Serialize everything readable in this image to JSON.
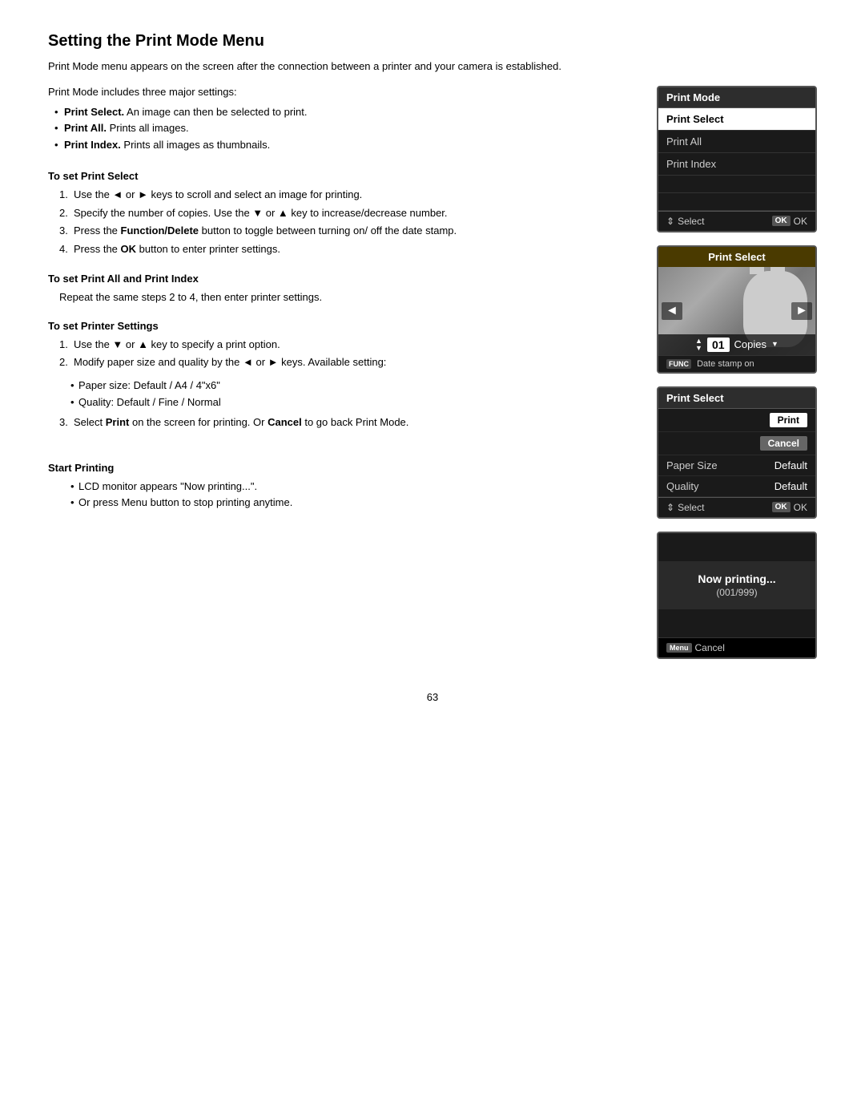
{
  "page": {
    "title": "Setting the Print Mode Menu",
    "intro": "Print Mode menu appears on the screen after the connection between a printer and your camera is established.",
    "includes_label": "Print Mode includes three major settings:",
    "bullets": [
      {
        "bold": "Print Select.",
        "text": " An image can then be selected to print."
      },
      {
        "bold": "Print All.",
        "text": " Prints all images."
      },
      {
        "bold": "Print Index.",
        "text": " Prints all images as thumbnails."
      }
    ],
    "sections": [
      {
        "id": "print-select",
        "title": "To set Print Select",
        "steps": [
          {
            "num": "1.",
            "text": "Use the ◄ or ► keys to scroll and select an image for printing."
          },
          {
            "num": "2.",
            "text": "Specify the number of copies. Use the ▼ or ▲ key to increase/decrease number."
          },
          {
            "num": "3.",
            "text": "Press the Function/Delete button to toggle between turning on/ off the date stamp."
          },
          {
            "num": "4.",
            "text": "Press the OK button to enter printer settings."
          }
        ]
      },
      {
        "id": "print-all",
        "title": "To set Print All and Print Index",
        "note": "Repeat the same steps 2 to 4, then enter printer settings."
      },
      {
        "id": "printer-settings",
        "title": "To set Printer Settings",
        "steps": [
          {
            "num": "1.",
            "text": "Use the ▼ or ▲ key to specify a print option."
          },
          {
            "num": "2.",
            "text": "Modify paper size and quality by the ◄ or ► keys. Available setting:"
          }
        ],
        "sub_bullets": [
          "Paper size: Default / A4 / 4\"x6\"",
          "Quality: Default / Fine / Normal"
        ],
        "extra_steps": [
          {
            "num": "3.",
            "text": "Select Print on the screen for printing. Or Cancel to go back Print Mode."
          }
        ]
      },
      {
        "id": "start-printing",
        "title": "Start Printing",
        "sub_bullets": [
          "LCD monitor appears \"Now printing...\".",
          "Or press Menu button to stop printing anytime."
        ]
      }
    ],
    "page_number": "63"
  },
  "panels": {
    "print_mode": {
      "header": "Print Mode",
      "items": [
        {
          "label": "Print Select",
          "selected": true
        },
        {
          "label": "Print All",
          "selected": false
        },
        {
          "label": "Print Index",
          "selected": false
        }
      ],
      "footer_select": "Select",
      "footer_ok": "OK"
    },
    "print_select_image": {
      "header": "Print Select",
      "copies_label": "Copies",
      "copies_value": "01",
      "stamp_label": "Date stamp on",
      "func_badge": "FUNC"
    },
    "printer_settings": {
      "header": "Print Select",
      "print_btn": "Print",
      "cancel_btn": "Cancel",
      "paper_size_label": "Paper Size",
      "paper_size_value": "Default",
      "quality_label": "Quality",
      "quality_value": "Default",
      "footer_select": "Select",
      "footer_ok": "OK"
    },
    "now_printing": {
      "text": "Now printing...",
      "counter": "(001/999)",
      "cancel_label": "Cancel",
      "menu_badge": "Menu"
    }
  }
}
